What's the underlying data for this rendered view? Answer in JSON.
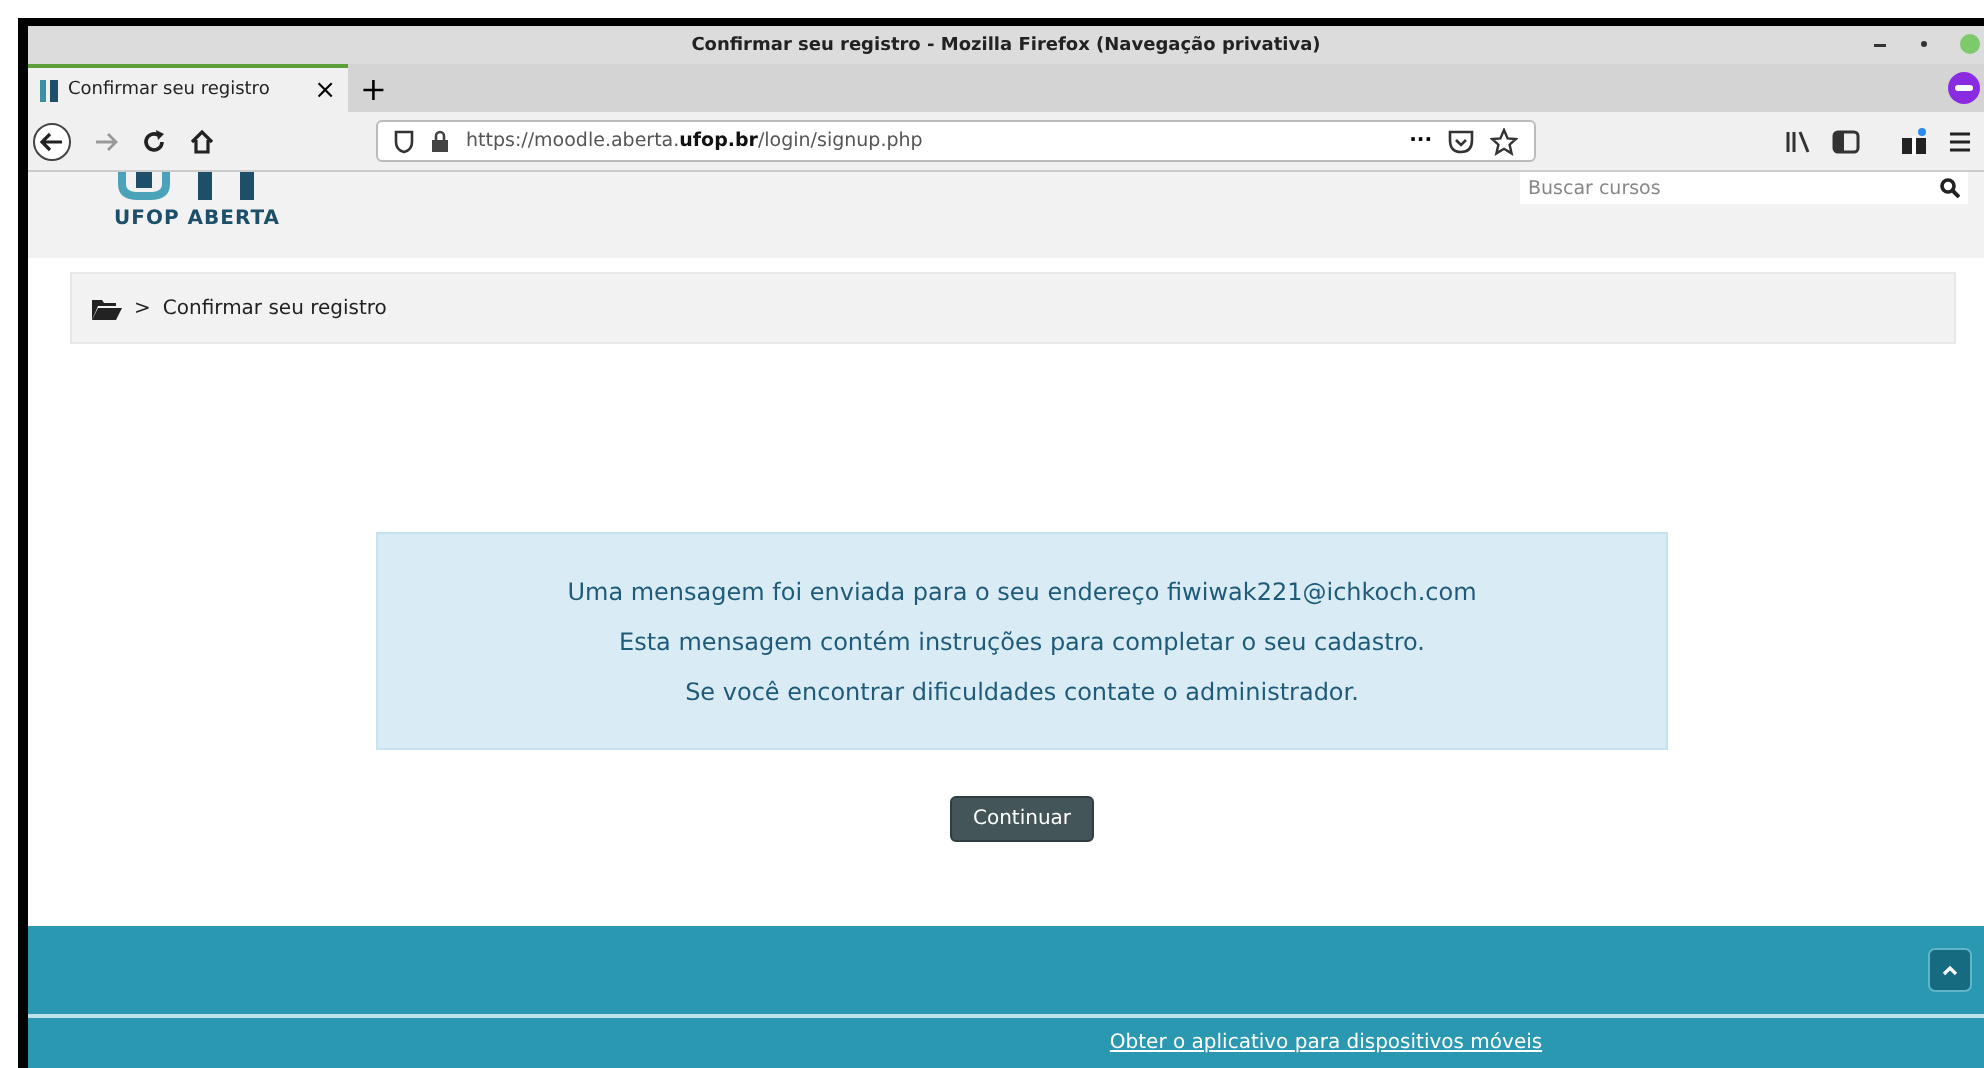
{
  "window": {
    "title": "Confirmar seu registro - Mozilla Firefox (Navegação privativa)"
  },
  "tabs": [
    {
      "label": "Confirmar seu registro",
      "selected": true,
      "close": "×"
    }
  ],
  "new_tab": "+",
  "address": {
    "scheme": "https://moodle.aberta.",
    "domain": "ufop.br",
    "path": "/login/signup.php",
    "more": "···"
  },
  "site": {
    "logo_text": "UFOP ABERTA",
    "search": {
      "placeholder": "Buscar cursos"
    }
  },
  "breadcrumb": {
    "separator": ">",
    "items": [
      "Confirmar seu registro"
    ]
  },
  "message": {
    "lines": [
      "Uma mensagem foi enviada para o seu endereço fiwiwak221@ichkoch.com",
      "Esta mensagem contém instruções para completar o seu cadastro.",
      "Se você encontrar dificuldades contate o administrador."
    ]
  },
  "buttons": [
    "Continuar"
  ],
  "footer": {
    "link": "Obter o aplicativo para dispositivos móveis"
  }
}
